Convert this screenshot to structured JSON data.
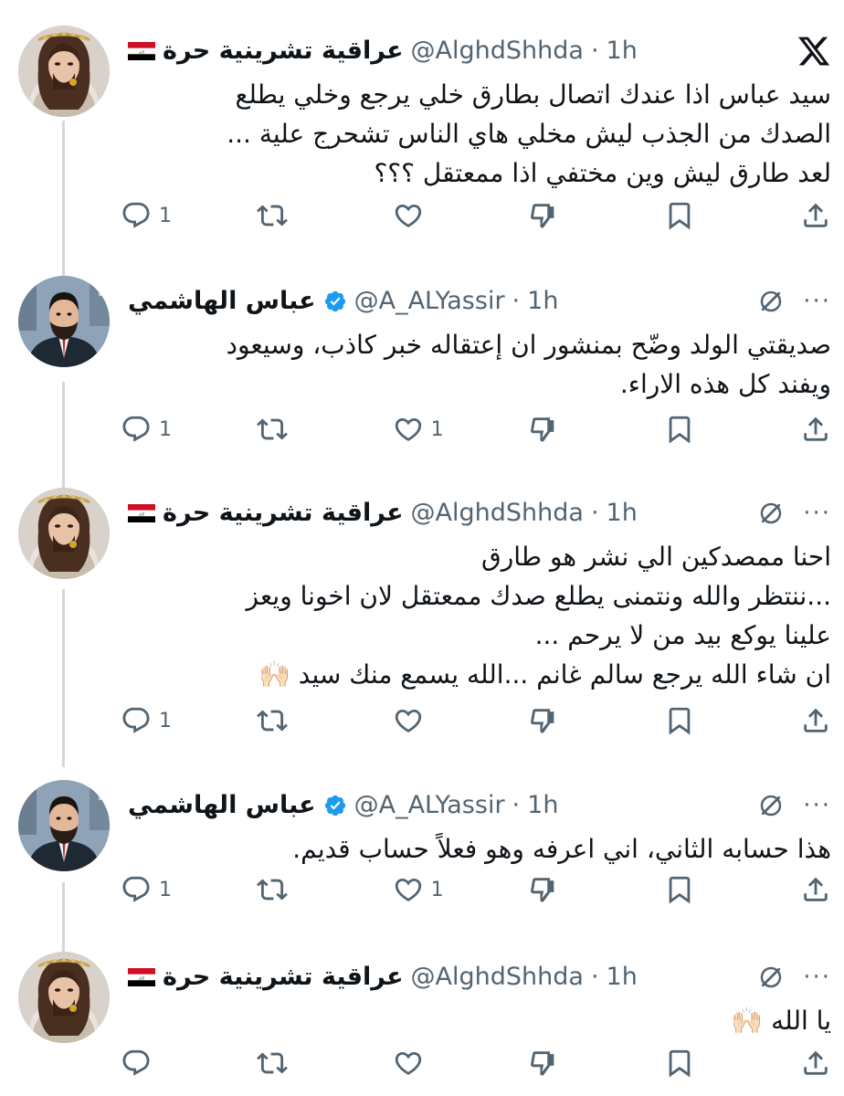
{
  "tweets": [
    {
      "name": "عراقية تشرينية حرة",
      "has_flag": true,
      "verified": false,
      "handle": "@AlghdShhda",
      "dot": "·",
      "time": "1h",
      "text": "سيد عباس اذا عندك اتصال بطارق خلي يرجع وخلي يطلع\nالصدك من الجذب ليش مخلي هاي الناس تشحرج علية ...\nلعد طارق ليش وين مختفي اذا ممعتقل ؟؟؟",
      "reply_count": "1",
      "like_count": ""
    },
    {
      "name": "عباس الهاشمي",
      "has_flag": false,
      "verified": true,
      "handle": "@A_ALYassir",
      "dot": "·",
      "time": "1h",
      "text": "صديقتي الولد وضّح بمنشور ان إعتقاله خبر كاذب، وسيعود\nويفند كل هذه الاراء.",
      "reply_count": "1",
      "like_count": "1"
    },
    {
      "name": "عراقية تشرينية حرة",
      "has_flag": true,
      "verified": false,
      "handle": "@AlghdShhda",
      "dot": "·",
      "time": "1h",
      "text": "احنا ممصدكين الي نشر هو طارق\n...ننتظر والله ونتمنى يطلع صدك ممعتقل لان اخونا ويعز\nعلينا يوكع بيد من لا يرحم ...\nان شاء الله يرجع سالم غانم ...الله يسمع منك سيد 🙌🏻",
      "reply_count": "1",
      "like_count": ""
    },
    {
      "name": "عباس الهاشمي",
      "has_flag": false,
      "verified": true,
      "handle": "@A_ALYassir",
      "dot": "·",
      "time": "1h",
      "text": "هذا حسابه الثاني، اني اعرفه وهو فعلاً حساب قديم.",
      "reply_count": "1",
      "like_count": "1"
    },
    {
      "name": "عراقية تشرينية حرة",
      "has_flag": true,
      "verified": false,
      "handle": "@AlghdShhda",
      "dot": "·",
      "time": "1h",
      "text": "يا الله 🙌🏻",
      "reply_count": "",
      "like_count": ""
    }
  ],
  "icons": {
    "header_first": "x-logo-icon",
    "header_rest": [
      "grok-icon",
      "more-icon"
    ],
    "actions": [
      "reply-icon",
      "retweet-icon",
      "like-icon",
      "dislike-icon",
      "bookmark-icon",
      "share-icon"
    ]
  },
  "more_glyph": "···",
  "colors": {
    "text": "#0f1419",
    "secondary": "#536471",
    "thread_line": "#cfd9de",
    "verified": "#1d9bf0"
  }
}
